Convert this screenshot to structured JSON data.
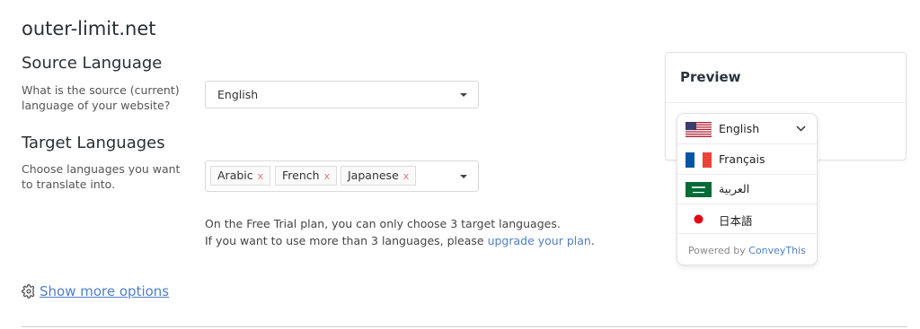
{
  "site": {
    "title": "outer-limit.net"
  },
  "source": {
    "heading": "Source Language",
    "description": "What is the source (current) language of your website?",
    "selected": "English"
  },
  "target": {
    "heading": "Target Languages",
    "description": "Choose languages you want to translate into.",
    "tags": [
      "Arabic",
      "French",
      "Japanese"
    ],
    "remove_glyph": "x"
  },
  "notice": {
    "line1": "On the Free Trial plan, you can only choose 3 target languages.",
    "line2_prefix": "If you want to use more than 3 languages, please ",
    "link": "upgrade your plan",
    "line2_suffix": "."
  },
  "options": {
    "show_more": "Show more options",
    "icon": "gear-icon"
  },
  "preview": {
    "title": "Preview",
    "current": {
      "label": "English",
      "flag": "us-flag"
    },
    "languages": [
      {
        "label": "Français",
        "flag": "fr-flag"
      },
      {
        "label": "العربية",
        "flag": "sa-flag"
      },
      {
        "label": "日本語",
        "flag": "jp-flag"
      }
    ],
    "powered_prefix": "Powered by ",
    "powered_brand": "ConveyThis"
  },
  "colors": {
    "link": "#4f7fc4",
    "remove_x": "#e07b7b",
    "text": "#2b2f33"
  }
}
